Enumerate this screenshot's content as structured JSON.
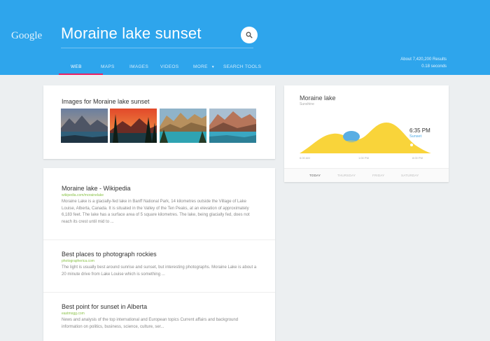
{
  "header": {
    "logo": "Google",
    "query": "Moraine lake sunset",
    "search_icon": "search-icon",
    "stats_count": "About 7,420,200 Results",
    "stats_time": "0.18 seconds",
    "colors": {
      "header_bg": "#2ea5ec",
      "tab_indicator": "#e91e63"
    }
  },
  "tabs": [
    {
      "label": "WEB",
      "active": true
    },
    {
      "label": "MAPS"
    },
    {
      "label": "IMAGES"
    },
    {
      "label": "VIDEOS"
    },
    {
      "label": "MORE"
    },
    {
      "label": "SEARCH TOOLS"
    }
  ],
  "images": {
    "title": "Images for Moraine lake sunset"
  },
  "weather": {
    "title": "Moraine lake",
    "subtitle": "Sunshine",
    "time": "6:35 PM",
    "event": "Sunset",
    "axis_labels": [
      "6:00 AM",
      "1:00 PM",
      "8:00 PM"
    ],
    "days": [
      "TODAY",
      "THURSDAY",
      "FRIDAY",
      "SATURDAY"
    ],
    "colors": {
      "sun": "#f9d43a",
      "cloud": "#5aaee3"
    }
  },
  "results": [
    {
      "title": "Moraine lake - Wikipedia",
      "url": "wikipedia.com/morainelake",
      "snippet": "Moraine Lake is a glacially-fed lake in Banff National Park, 14 kilometres outside the Village of Lake Louise, Alberta, Canada. It is situated in the Valley of the Ten Peaks, at an elevation of approximately 6,183 feet. The lake has a surface area of 5 square kilometres. The lake, being glacially fed, does not reach its crest until mid to ..."
    },
    {
      "title": "Best places to photograph rockies",
      "url": "photographerica.com",
      "snippet": "The light is usually best around sunrise and sunset, but interesting photographs. Moraine Lake is about a 20 minute drive from Lake Louise which is something ..."
    },
    {
      "title": "Best point for sunset in Alberta",
      "url": "eastmogg.com",
      "snippet": "News and analysis of the top international and European topics Current affairs and background information on politics, business, science, culture, ser..."
    }
  ]
}
